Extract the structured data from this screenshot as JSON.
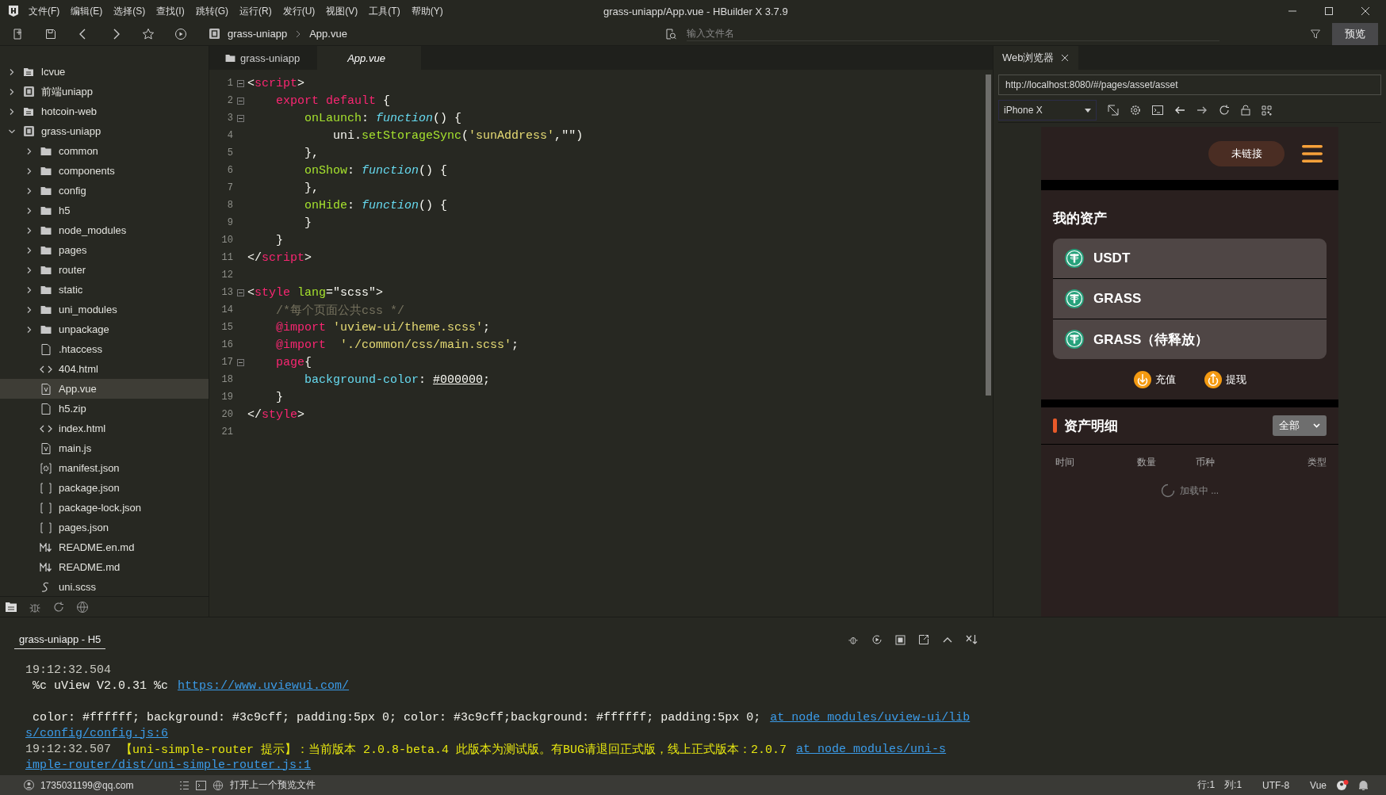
{
  "window": {
    "title": "grass-uniapp/App.vue - HBuilder X 3.7.9",
    "menu": [
      "文件(F)",
      "编辑(E)",
      "选择(S)",
      "查找(I)",
      "跳转(G)",
      "运行(R)",
      "发行(U)",
      "视图(V)",
      "工具(T)",
      "帮助(Y)"
    ]
  },
  "toolbar": {
    "breadcrumb": [
      "grass-uniapp",
      "App.vue"
    ],
    "file_search": {
      "placeholder": "输入文件名"
    },
    "preview_button": "预览"
  },
  "sidebar": {
    "tree": [
      {
        "label": "lcvue",
        "kind": "workspace",
        "expanded": false,
        "selected": false
      },
      {
        "label": "前端uniapp",
        "kind": "project",
        "expanded": false,
        "selected": false
      },
      {
        "label": "hotcoin-web",
        "kind": "workspace",
        "expanded": false,
        "selected": false
      },
      {
        "label": "grass-uniapp",
        "kind": "project",
        "expanded": true,
        "selected": false,
        "children": [
          {
            "label": "common",
            "kind": "folder",
            "expanded": false,
            "selected": false
          },
          {
            "label": "components",
            "kind": "folder",
            "expanded": false,
            "selected": false
          },
          {
            "label": "config",
            "kind": "folder",
            "expanded": false,
            "selected": false
          },
          {
            "label": "h5",
            "kind": "folder",
            "expanded": false,
            "selected": false
          },
          {
            "label": "node_modules",
            "kind": "folder",
            "expanded": false,
            "selected": false
          },
          {
            "label": "pages",
            "kind": "folder",
            "expanded": false,
            "selected": false
          },
          {
            "label": "router",
            "kind": "folder",
            "expanded": false,
            "selected": false
          },
          {
            "label": "static",
            "kind": "folder",
            "expanded": false,
            "selected": false
          },
          {
            "label": "uni_modules",
            "kind": "folder",
            "expanded": false,
            "selected": false
          },
          {
            "label": "unpackage",
            "kind": "folder",
            "expanded": false,
            "selected": false
          },
          {
            "label": ".htaccess",
            "kind": "file",
            "selected": false
          },
          {
            "label": "404.html",
            "kind": "html",
            "selected": false
          },
          {
            "label": "App.vue",
            "kind": "vue",
            "selected": true
          },
          {
            "label": "h5.zip",
            "kind": "file",
            "selected": false
          },
          {
            "label": "index.html",
            "kind": "html",
            "selected": false
          },
          {
            "label": "main.js",
            "kind": "js",
            "selected": false
          },
          {
            "label": "manifest.json",
            "kind": "manifest",
            "selected": false
          },
          {
            "label": "package.json",
            "kind": "json",
            "selected": false
          },
          {
            "label": "package-lock.json",
            "kind": "json",
            "selected": false
          },
          {
            "label": "pages.json",
            "kind": "json",
            "selected": false
          },
          {
            "label": "README.en.md",
            "kind": "md",
            "selected": false
          },
          {
            "label": "README.md",
            "kind": "md",
            "selected": false
          },
          {
            "label": "uni.scss",
            "kind": "scss",
            "selected": false
          }
        ]
      }
    ]
  },
  "editor": {
    "tabs": [
      {
        "label": "grass-uniapp",
        "kind": "folder",
        "selected": false
      },
      {
        "label": "App.vue",
        "kind": "file",
        "selected": true
      }
    ],
    "lines": [
      {
        "number": "1",
        "foldable": true,
        "tokens": [
          {
            "text": "<",
            "kind": "p"
          },
          {
            "text": "script",
            "kind": "tag"
          },
          {
            "text": ">",
            "kind": "p"
          }
        ]
      },
      {
        "number": "2",
        "foldable": true,
        "tokens": [
          {
            "text": "    export default",
            "kind": "kw"
          },
          {
            "text": " {",
            "kind": "p"
          }
        ]
      },
      {
        "number": "3",
        "foldable": true,
        "tokens": [
          {
            "text": "        onLaunch",
            "kind": "prop"
          },
          {
            "text": ": ",
            "kind": "p"
          },
          {
            "text": "function",
            "kind": "fn"
          },
          {
            "text": "() {",
            "kind": "p"
          }
        ]
      },
      {
        "number": "4",
        "foldable": false,
        "tokens": [
          {
            "text": "            uni.",
            "kind": "p"
          },
          {
            "text": "setStorageSync",
            "kind": "prop"
          },
          {
            "text": "(",
            "kind": "p"
          },
          {
            "text": "'sunAddress'",
            "kind": "str"
          },
          {
            "text": ",",
            "kind": "p"
          },
          {
            "text": "\"\"",
            "kind": "p"
          },
          {
            "text": ")",
            "kind": "p"
          }
        ]
      },
      {
        "number": "5",
        "foldable": false,
        "tokens": [
          {
            "text": "        },",
            "kind": "p"
          }
        ]
      },
      {
        "number": "6",
        "foldable": false,
        "tokens": [
          {
            "text": "        onShow",
            "kind": "prop"
          },
          {
            "text": ": ",
            "kind": "p"
          },
          {
            "text": "function",
            "kind": "fn"
          },
          {
            "text": "() {",
            "kind": "p"
          }
        ]
      },
      {
        "number": "7",
        "foldable": false,
        "tokens": [
          {
            "text": "        },",
            "kind": "p"
          }
        ]
      },
      {
        "number": "8",
        "foldable": false,
        "tokens": [
          {
            "text": "        onHide",
            "kind": "prop"
          },
          {
            "text": ": ",
            "kind": "p"
          },
          {
            "text": "function",
            "kind": "fn"
          },
          {
            "text": "() {",
            "kind": "p"
          }
        ]
      },
      {
        "number": "9",
        "foldable": false,
        "tokens": [
          {
            "text": "        }",
            "kind": "p"
          }
        ]
      },
      {
        "number": "10",
        "foldable": false,
        "tokens": [
          {
            "text": "    }",
            "kind": "p"
          }
        ]
      },
      {
        "number": "11",
        "foldable": false,
        "tokens": [
          {
            "text": "</",
            "kind": "p"
          },
          {
            "text": "script",
            "kind": "tag"
          },
          {
            "text": ">",
            "kind": "p"
          }
        ]
      },
      {
        "number": "12",
        "foldable": false
      },
      {
        "number": "13",
        "foldable": true,
        "tokens": [
          {
            "text": "<",
            "kind": "p"
          },
          {
            "text": "style",
            "kind": "tag"
          },
          {
            "text": " lang",
            "kind": "attr"
          },
          {
            "text": "=",
            "kind": "p"
          },
          {
            "text": "\"scss\"",
            "kind": "p"
          },
          {
            "text": ">",
            "kind": "p"
          }
        ]
      },
      {
        "number": "14",
        "foldable": false,
        "tokens": [
          {
            "text": "    /*每个页面公共css */",
            "kind": "cm"
          }
        ]
      },
      {
        "number": "15",
        "foldable": false,
        "tokens": [
          {
            "text": "    @import ",
            "kind": "kw"
          },
          {
            "text": "'uview-ui/theme.scss'",
            "kind": "str"
          },
          {
            "text": ";",
            "kind": "p"
          }
        ]
      },
      {
        "number": "16",
        "foldable": false,
        "tokens": [
          {
            "text": "    @import  ",
            "kind": "kw"
          },
          {
            "text": "'./common/css/main.scss'",
            "kind": "str"
          },
          {
            "text": ";",
            "kind": "p"
          }
        ]
      },
      {
        "number": "17",
        "foldable": true,
        "tokens": [
          {
            "text": "    page",
            "kind": "kw"
          },
          {
            "text": "{",
            "kind": "p"
          }
        ]
      },
      {
        "number": "18",
        "foldable": false,
        "tokens": [
          {
            "text": "        background-color",
            "kind": "css"
          },
          {
            "text": ": ",
            "kind": "p"
          },
          {
            "text": "#000000",
            "kind": "val"
          },
          {
            "text": ";",
            "kind": "p"
          }
        ]
      },
      {
        "number": "19",
        "foldable": false,
        "tokens": [
          {
            "text": "    }",
            "kind": "p"
          }
        ]
      },
      {
        "number": "20",
        "foldable": false,
        "tokens": [
          {
            "text": "</",
            "kind": "p"
          },
          {
            "text": "style",
            "kind": "tag"
          },
          {
            "text": ">",
            "kind": "p"
          }
        ]
      },
      {
        "number": "21",
        "foldable": false
      }
    ]
  },
  "browser": {
    "tab": "Web浏览器",
    "url": "http://localhost:8080/#/pages/asset/asset",
    "device": "iPhone X",
    "page": {
      "connect_button": "未链接",
      "assets_title": "我的资产",
      "assets": [
        "USDT",
        "GRASS",
        "GRASS（待释放）"
      ],
      "actions": [
        {
          "label": "充值",
          "kind": "deposit"
        },
        {
          "label": "提现",
          "kind": "withdraw"
        }
      ],
      "detail_title": "资产明细",
      "filter": "全部",
      "columns": [
        "时间",
        "数量",
        "币种",
        "类型"
      ],
      "loading": "加载中 ..."
    }
  },
  "console": {
    "tab": "grass-uniapp - H5",
    "rows": [
      {
        "kind": "line",
        "segments": [
          {
            "text": "19:12:32.504",
            "kind": "time"
          }
        ]
      },
      {
        "kind": "line",
        "segments": [
          {
            "text": " %c uView V2.0.31 %c",
            "kind": "text"
          },
          {
            "text": "https://www.uviewui.com/",
            "kind": "link"
          }
        ]
      },
      {
        "kind": "blank"
      },
      {
        "kind": "line",
        "segments": [
          {
            "text": " color: #ffffff; background: #3c9cff; padding:5px 0; color: #3c9cff;background: #ffffff; padding:5px 0;",
            "kind": "text"
          },
          {
            "text": "at node_modules/uview-ui/lib",
            "kind": "link"
          }
        ]
      },
      {
        "kind": "line",
        "segments": [
          {
            "text": "s/config/config.js:6",
            "kind": "link"
          }
        ]
      },
      {
        "kind": "line",
        "segments": [
          {
            "text": "19:12:32.507",
            "kind": "time"
          },
          {
            "text": "【uni-simple-router 提示】：当前版本 2.0.8-beta.4 此版本为测试版。有BUG请退回正式版，线上正式版本：2.0.7",
            "kind": "warn"
          },
          {
            "text": "at node_modules/uni-s",
            "kind": "link"
          }
        ]
      },
      {
        "kind": "line",
        "segments": [
          {
            "text": "imple-router/dist/uni-simple-router.js:1",
            "kind": "link"
          }
        ]
      }
    ]
  },
  "status_bar": {
    "account": "1735031199@qq.com",
    "action": "打开上一个预览文件",
    "position": [
      "行:1",
      "列:1"
    ],
    "encoding": "UTF-8",
    "language": "Vue"
  }
}
